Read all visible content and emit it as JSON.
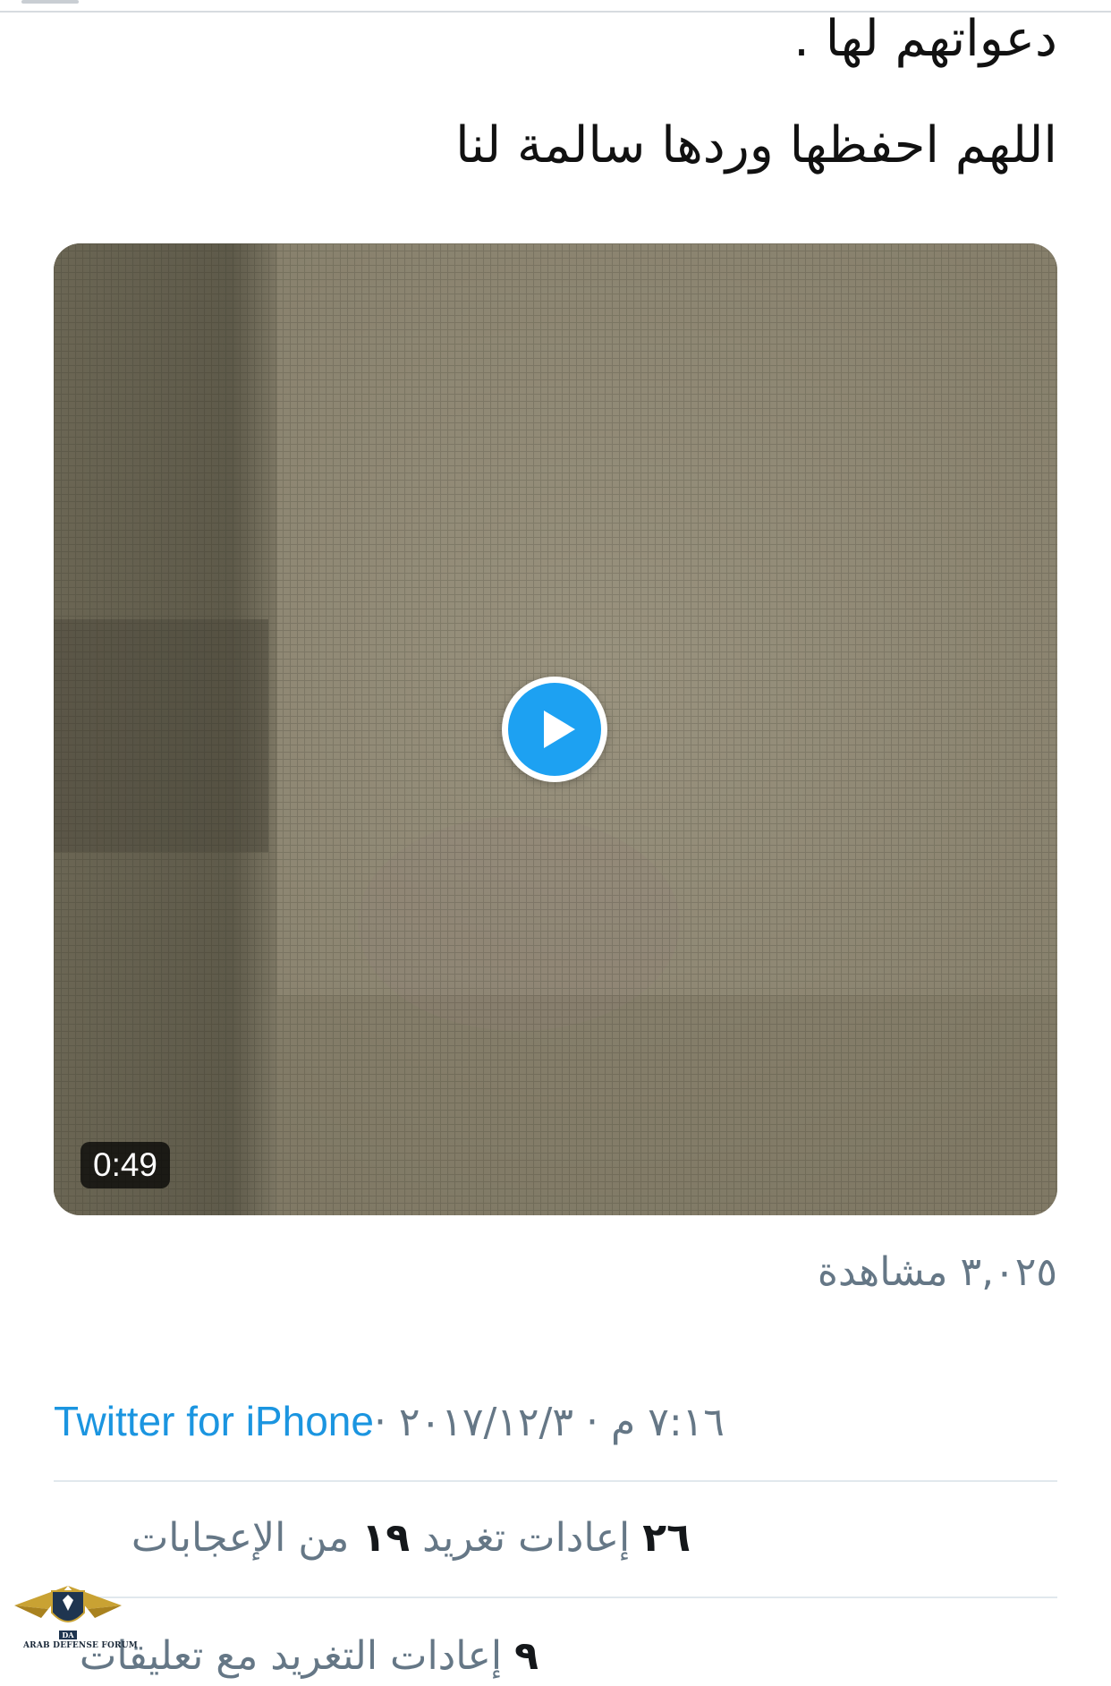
{
  "tweet": {
    "text_line_1": "دعواتهم لها .",
    "text_line_2": "اللهم احفظها وردها سالمة لنا"
  },
  "video": {
    "duration": "0:49",
    "play_icon": "play-icon"
  },
  "views": {
    "label": "٣,٠٢٥ مشاهدة"
  },
  "meta": {
    "time_date": "٧:١٦ م · ٢٠١٧/١٢/٣ · ",
    "source": "Twitter for iPhone"
  },
  "stats": {
    "retweets_count": "٢٦",
    "retweets_label": " إعادات تغريد  ",
    "likes_count": "١٩",
    "likes_label": " من الإعجابات",
    "quotes_count": "٩",
    "quotes_label": " إعادات التغريد مع تعليقات"
  },
  "watermark": {
    "text": "ARAB DEFENSE FORUM",
    "logo": "arab-defense-forum-logo"
  },
  "colors": {
    "link": "#1b95e0",
    "secondary_text": "#657786",
    "play_button": "#1da1f2",
    "divider": "#e1e8ed"
  }
}
